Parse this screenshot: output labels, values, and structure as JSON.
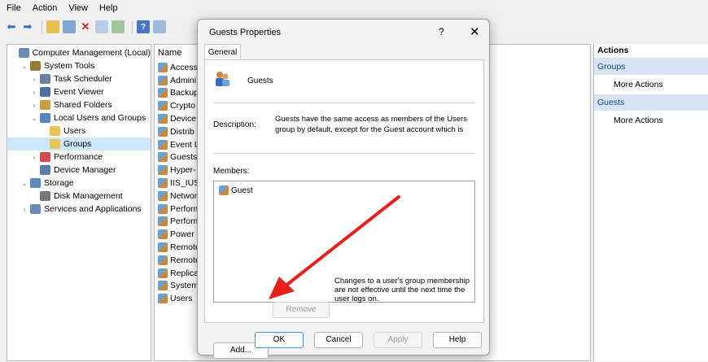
{
  "menu": [
    "File",
    "Action",
    "View",
    "Help"
  ],
  "toolbar": [
    "back-icon",
    "forward-icon",
    "up-folder-icon",
    "console-tree-icon",
    "delete-icon",
    "properties-icon",
    "export-icon",
    "help-icon",
    "show-hide-icon"
  ],
  "tree": [
    {
      "label": "Computer Management (Local)",
      "indent": 0,
      "twisty": "",
      "icon": "#6a8bb8"
    },
    {
      "label": "System Tools",
      "indent": 1,
      "twisty": "v",
      "icon": "#9a7a3a"
    },
    {
      "label": "Task Scheduler",
      "indent": 2,
      "twisty": ">",
      "icon": "#6b7fa3"
    },
    {
      "label": "Event Viewer",
      "indent": 2,
      "twisty": ">",
      "icon": "#4a6fa8"
    },
    {
      "label": "Shared Folders",
      "indent": 2,
      "twisty": ">",
      "icon": "#c9a040"
    },
    {
      "label": "Local Users and Groups",
      "indent": 2,
      "twisty": "v",
      "icon": "#5c84c4"
    },
    {
      "label": "Users",
      "indent": 3,
      "twisty": "",
      "icon": "#e7c455"
    },
    {
      "label": "Groups",
      "indent": 3,
      "twisty": "",
      "icon": "#e7c455",
      "selected": true
    },
    {
      "label": "Performance",
      "indent": 2,
      "twisty": ">",
      "icon": "#d24c4c"
    },
    {
      "label": "Device Manager",
      "indent": 2,
      "twisty": "",
      "icon": "#5a7da8"
    },
    {
      "label": "Storage",
      "indent": 1,
      "twisty": "v",
      "icon": "#5a8ac0"
    },
    {
      "label": "Disk Management",
      "indent": 2,
      "twisty": "",
      "icon": "#777777"
    },
    {
      "label": "Services and Applications",
      "indent": 1,
      "twisty": ">",
      "icon": "#6a8bb8"
    }
  ],
  "list": {
    "header": "Name",
    "rows": [
      "Access",
      "Admini",
      "Backup",
      "Crypto",
      "Device",
      "Distrib",
      "Event L",
      "Guests",
      "Hyper-",
      "IIS_IUSI",
      "Networ",
      "Perform",
      "Perform",
      "Power I",
      "Remote",
      "Remote",
      "Replica",
      "System",
      "Users"
    ]
  },
  "actions": {
    "header": "Actions",
    "sections": [
      {
        "title": "Groups",
        "item": "More Actions"
      },
      {
        "title": "Guests",
        "item": "More Actions"
      }
    ]
  },
  "dialog": {
    "title": "Guests Properties",
    "help": "?",
    "close": "✕",
    "tab": "General",
    "group_name": "Guests",
    "description_label": "Description:",
    "description_value": "Guests have the same access as members of the Users group by default, except for the Guest account which is",
    "members_label": "Members:",
    "members": [
      "Guest"
    ],
    "add_label": "Add...",
    "remove_label": "Remove",
    "note": "Changes to a user's group membership are not effective until the next time the user logs on.",
    "ok_label": "OK",
    "cancel_label": "Cancel",
    "apply_label": "Apply",
    "help_label": "Help"
  },
  "annotation_color": "#e8201c"
}
